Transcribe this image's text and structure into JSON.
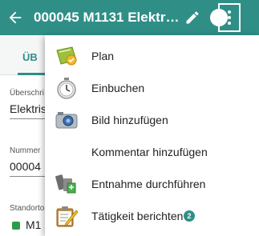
{
  "header": {
    "title": "000045 M1131 Elektro...",
    "back_icon": "arrow-left-icon",
    "edit_icon": "pencil-icon",
    "info_label": "!",
    "more_icon": "more-vertical-icon"
  },
  "tabs": [
    {
      "label": "ÜB"
    }
  ],
  "form": {
    "fields": [
      {
        "label": "Überschri",
        "value": "Elektris"
      },
      {
        "label": "Nummer",
        "value": "00004"
      },
      {
        "label": "Standorto",
        "value": "M1"
      }
    ]
  },
  "menu": {
    "items": [
      {
        "label": "Plan",
        "icon": "plan-icon"
      },
      {
        "label": "Einbuchen",
        "icon": "stopwatch-icon"
      },
      {
        "label": "Bild hinzufügen",
        "icon": "camera-icon"
      },
      {
        "label": "Kommentar hinzufügen",
        "icon": ""
      },
      {
        "label": "Entnahme durchführen",
        "icon": "tools-icon"
      },
      {
        "label": "Tätigkeit berichten",
        "icon": "clipboard-icon",
        "badge": "2"
      }
    ]
  },
  "colors": {
    "primary": "#2f8f87",
    "badge": "#2f8f87"
  }
}
